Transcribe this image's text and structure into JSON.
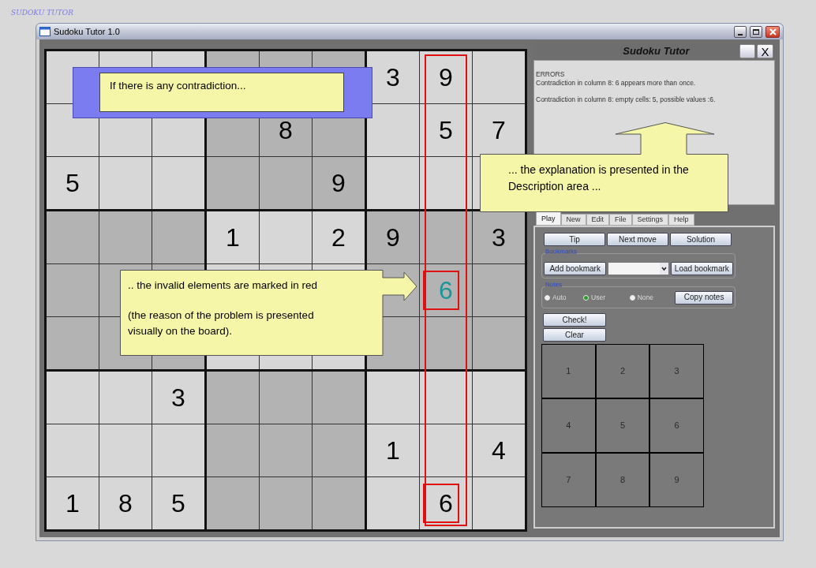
{
  "desktop_title": "SUDOKU TUTOR",
  "window": {
    "title": "Sudoku Tutor 1.0"
  },
  "board": {
    "columns": [
      {
        "highlighted": false
      },
      {
        "highlighted": false
      },
      {
        "highlighted": false
      },
      {
        "highlighted": false
      },
      {
        "highlighted": false
      },
      {
        "highlighted": false
      },
      {
        "highlighted": false
      },
      {
        "highlighted": true
      },
      {
        "highlighted": false
      }
    ],
    "rows": [
      [
        {
          "invalid": false
        },
        {
          "invalid": false
        },
        {
          "invalid": false
        },
        {
          "invalid": false
        },
        {
          "invalid": false
        },
        {
          "invalid": false
        },
        {
          "value": "3",
          "kind": "given",
          "invalid": false
        },
        {
          "value": "9",
          "kind": "given",
          "invalid": false
        },
        {
          "invalid": false
        }
      ],
      [
        {
          "invalid": false
        },
        {
          "invalid": false
        },
        {
          "invalid": false
        },
        {
          "invalid": false
        },
        {
          "value": "8",
          "kind": "given",
          "invalid": false
        },
        {
          "invalid": false
        },
        {
          "invalid": false
        },
        {
          "value": "5",
          "kind": "given",
          "invalid": false
        },
        {
          "value": "7",
          "kind": "given",
          "invalid": false
        }
      ],
      [
        {
          "value": "5",
          "kind": "given",
          "invalid": false
        },
        {
          "invalid": false
        },
        {
          "invalid": false
        },
        {
          "invalid": false
        },
        {
          "invalid": false
        },
        {
          "value": "9",
          "kind": "given",
          "invalid": false
        },
        {
          "invalid": false
        },
        {
          "invalid": false
        },
        {
          "invalid": false
        }
      ],
      [
        {
          "invalid": false
        },
        {
          "invalid": false
        },
        {
          "invalid": false
        },
        {
          "value": "1",
          "kind": "given",
          "invalid": false
        },
        {
          "invalid": false
        },
        {
          "value": "2",
          "kind": "given",
          "invalid": false
        },
        {
          "value": "9",
          "kind": "given",
          "invalid": false
        },
        {
          "invalid": false
        },
        {
          "value": "3",
          "kind": "given",
          "invalid": false
        }
      ],
      [
        {
          "invalid": false
        },
        {
          "invalid": false
        },
        {
          "invalid": false
        },
        {
          "invalid": false
        },
        {
          "invalid": false
        },
        {
          "invalid": false
        },
        {
          "invalid": false
        },
        {
          "value": "6",
          "kind": "user",
          "invalid": true
        },
        {
          "invalid": false
        }
      ],
      [
        {
          "invalid": false
        },
        {
          "invalid": false
        },
        {
          "invalid": false
        },
        {
          "invalid": false
        },
        {
          "invalid": false
        },
        {
          "invalid": false
        },
        {
          "invalid": false
        },
        {
          "invalid": false
        },
        {
          "invalid": false
        }
      ],
      [
        {
          "invalid": false
        },
        {
          "invalid": false
        },
        {
          "value": "3",
          "kind": "given",
          "invalid": false
        },
        {
          "invalid": false
        },
        {
          "invalid": false
        },
        {
          "invalid": false
        },
        {
          "invalid": false
        },
        {
          "invalid": false
        },
        {
          "invalid": false
        }
      ],
      [
        {
          "invalid": false
        },
        {
          "invalid": false
        },
        {
          "invalid": false
        },
        {
          "invalid": false
        },
        {
          "invalid": false
        },
        {
          "invalid": false
        },
        {
          "value": "1",
          "kind": "given",
          "invalid": false
        },
        {
          "invalid": false
        },
        {
          "value": "4",
          "kind": "given",
          "invalid": false
        }
      ],
      [
        {
          "value": "1",
          "kind": "given",
          "invalid": false
        },
        {
          "value": "8",
          "kind": "given",
          "invalid": false
        },
        {
          "value": "5",
          "kind": "given",
          "invalid": false
        },
        {
          "invalid": false
        },
        {
          "invalid": false
        },
        {
          "invalid": false
        },
        {
          "invalid": false
        },
        {
          "value": "6",
          "kind": "given",
          "invalid": true
        },
        {
          "invalid": false
        }
      ]
    ]
  },
  "description": {
    "title": "Sudoku Tutor",
    "close": "X",
    "lines": [
      "ERRORS",
      "Contradiction in column 8: 6 appears more than once.",
      "Contradiction in column 8: empty cells: 5, possible values :6."
    ]
  },
  "tabs": [
    {
      "label": "Play",
      "selected": true
    },
    {
      "label": "New",
      "selected": false
    },
    {
      "label": "Edit",
      "selected": false
    },
    {
      "label": "File",
      "selected": false
    },
    {
      "label": "Settings",
      "selected": false
    },
    {
      "label": "Help",
      "selected": false
    }
  ],
  "play": {
    "buttons": [
      "Tip",
      "Next move",
      "Solution"
    ],
    "bookmarks": {
      "label": "Bookmarks",
      "add": "Add bookmark",
      "load": "Load bookmark"
    },
    "notes": {
      "label": "Notes",
      "options": [
        {
          "label": "Auto",
          "selected": false
        },
        {
          "label": "User",
          "selected": true
        },
        {
          "label": "None",
          "selected": false
        }
      ],
      "copy": "Copy notes"
    },
    "check": "Check!",
    "clear": "Clear",
    "keypad": [
      "1",
      "2",
      "3",
      "4",
      "5",
      "6",
      "7",
      "8",
      "9"
    ]
  },
  "callouts": [
    {
      "kind": "framed",
      "paragraphs": [
        "If there is any contradiction..."
      ]
    },
    {
      "kind": "arrow_up",
      "paragraphs": [
        "... the explanation is presented in the Description area ..."
      ]
    },
    {
      "kind": "arrow_right",
      "paragraphs": [
        ".. the invalid elements are marked in red",
        "(the reason of the problem is presented visually on the board)."
      ]
    }
  ]
}
